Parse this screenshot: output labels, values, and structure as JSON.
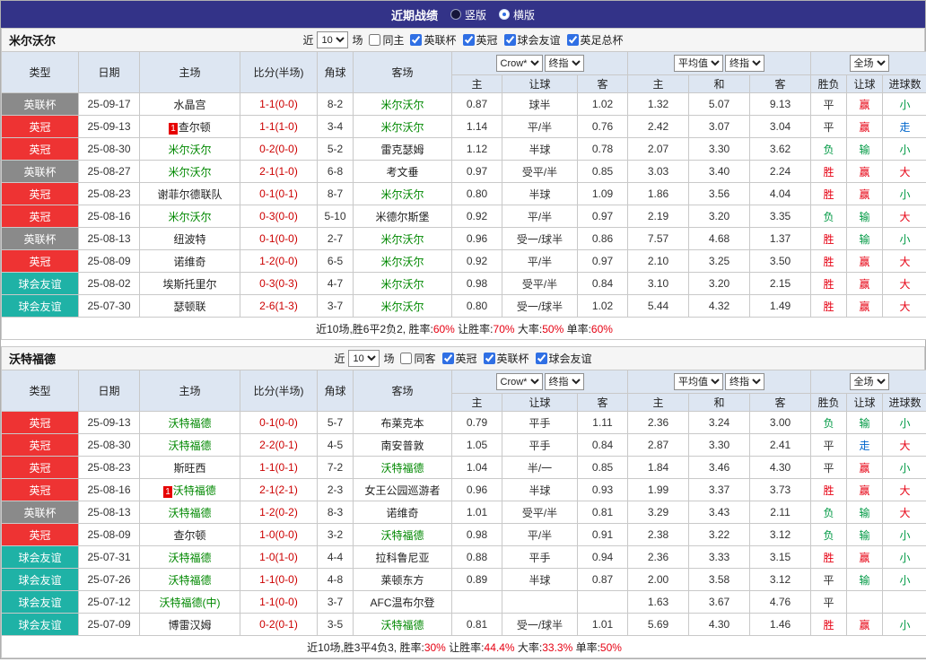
{
  "colors": {
    "topbar_bg": "#333388",
    "header_bg": "#dde6f2",
    "filter_bg": "#f5f5f5",
    "badge_cup": "#8a8a8a",
    "badge_league": "#ee3333",
    "badge_friendly": "#1fb2a6",
    "team_green": "#008800",
    "score_red": "#cc0000",
    "win_red": "#e60012",
    "lose_green": "#009944",
    "push_blue": "#0066cc"
  },
  "top_bar": {
    "title": "近期战绩",
    "options": [
      {
        "label": "竖版",
        "selected": false
      },
      {
        "label": "横版",
        "selected": true
      }
    ]
  },
  "table_header": {
    "type": "类型",
    "date": "日期",
    "home": "主场",
    "score": "比分(半场)",
    "corners": "角球",
    "away": "客场",
    "company_select": "Crow*",
    "final_select": "终指",
    "avg_select": "平均值",
    "avg_final_select": "终指",
    "full_select": "全场",
    "sub_headers": [
      "主",
      "让球",
      "客",
      "主",
      "和",
      "客",
      "胜负",
      "让球",
      "进球数"
    ]
  },
  "sections": [
    {
      "team": "米尔沃尔",
      "filter": {
        "prefix": "近",
        "count": "10",
        "suffix": "场",
        "checkboxes": [
          {
            "label": "同主",
            "checked": false
          },
          {
            "label": "英联杯",
            "checked": true
          },
          {
            "label": "英冠",
            "checked": true
          },
          {
            "label": "球会友谊",
            "checked": true
          },
          {
            "label": "英足总杯",
            "checked": true
          }
        ]
      },
      "rows": [
        {
          "type": "英联杯",
          "date": "25-09-17",
          "home": "水晶宫",
          "home_team": false,
          "rank": "",
          "score": "1-1(0-0)",
          "corners": "8-2",
          "away": "米尔沃尔",
          "away_team": true,
          "ah": [
            "0.87",
            "球半",
            "1.02"
          ],
          "eu": [
            "1.32",
            "5.07",
            "9.13"
          ],
          "res": [
            "平",
            "赢",
            "小"
          ]
        },
        {
          "type": "英冠",
          "date": "25-09-13",
          "home": "查尔顿",
          "home_team": false,
          "rank": "1",
          "score": "1-1(1-0)",
          "corners": "3-4",
          "away": "米尔沃尔",
          "away_team": true,
          "ah": [
            "1.14",
            "平/半",
            "0.76"
          ],
          "eu": [
            "2.42",
            "3.07",
            "3.04"
          ],
          "res": [
            "平",
            "赢",
            "走"
          ]
        },
        {
          "type": "英冠",
          "date": "25-08-30",
          "home": "米尔沃尔",
          "home_team": true,
          "rank": "",
          "score": "0-2(0-0)",
          "corners": "5-2",
          "away": "雷克瑟姆",
          "away_team": false,
          "ah": [
            "1.12",
            "半球",
            "0.78"
          ],
          "eu": [
            "2.07",
            "3.30",
            "3.62"
          ],
          "res": [
            "负",
            "输",
            "小"
          ]
        },
        {
          "type": "英联杯",
          "date": "25-08-27",
          "home": "米尔沃尔",
          "home_team": true,
          "rank": "",
          "score": "2-1(1-0)",
          "corners": "6-8",
          "away": "考文垂",
          "away_team": false,
          "ah": [
            "0.97",
            "受平/半",
            "0.85"
          ],
          "eu": [
            "3.03",
            "3.40",
            "2.24"
          ],
          "res": [
            "胜",
            "赢",
            "大"
          ]
        },
        {
          "type": "英冠",
          "date": "25-08-23",
          "home": "谢菲尔德联队",
          "home_team": false,
          "rank": "",
          "score": "0-1(0-1)",
          "corners": "8-7",
          "away": "米尔沃尔",
          "away_team": true,
          "ah": [
            "0.80",
            "半球",
            "1.09"
          ],
          "eu": [
            "1.86",
            "3.56",
            "4.04"
          ],
          "res": [
            "胜",
            "赢",
            "小"
          ]
        },
        {
          "type": "英冠",
          "date": "25-08-16",
          "home": "米尔沃尔",
          "home_team": true,
          "rank": "",
          "score": "0-3(0-0)",
          "corners": "5-10",
          "away": "米德尔斯堡",
          "away_team": false,
          "ah": [
            "0.92",
            "平/半",
            "0.97"
          ],
          "eu": [
            "2.19",
            "3.20",
            "3.35"
          ],
          "res": [
            "负",
            "输",
            "大"
          ]
        },
        {
          "type": "英联杯",
          "date": "25-08-13",
          "home": "纽波特",
          "home_team": false,
          "rank": "",
          "score": "0-1(0-0)",
          "corners": "2-7",
          "away": "米尔沃尔",
          "away_team": true,
          "ah": [
            "0.96",
            "受一/球半",
            "0.86"
          ],
          "eu": [
            "7.57",
            "4.68",
            "1.37"
          ],
          "res": [
            "胜",
            "输",
            "小"
          ]
        },
        {
          "type": "英冠",
          "date": "25-08-09",
          "home": "诺维奇",
          "home_team": false,
          "rank": "",
          "score": "1-2(0-0)",
          "corners": "6-5",
          "away": "米尔沃尔",
          "away_team": true,
          "ah": [
            "0.92",
            "平/半",
            "0.97"
          ],
          "eu": [
            "2.10",
            "3.25",
            "3.50"
          ],
          "res": [
            "胜",
            "赢",
            "大"
          ]
        },
        {
          "type": "球会友谊",
          "date": "25-08-02",
          "home": "埃斯托里尔",
          "home_team": false,
          "rank": "",
          "score": "0-3(0-3)",
          "corners": "4-7",
          "away": "米尔沃尔",
          "away_team": true,
          "ah": [
            "0.98",
            "受平/半",
            "0.84"
          ],
          "eu": [
            "3.10",
            "3.20",
            "2.15"
          ],
          "res": [
            "胜",
            "赢",
            "大"
          ]
        },
        {
          "type": "球会友谊",
          "date": "25-07-30",
          "home": "瑟顿联",
          "home_team": false,
          "rank": "",
          "score": "2-6(1-3)",
          "corners": "3-7",
          "away": "米尔沃尔",
          "away_team": true,
          "ah": [
            "0.80",
            "受一/球半",
            "1.02"
          ],
          "eu": [
            "5.44",
            "4.32",
            "1.49"
          ],
          "res": [
            "胜",
            "赢",
            "大"
          ]
        }
      ],
      "summary": {
        "prefix": "近10场,胜6平2负2,",
        "stats": [
          {
            "label": "胜率:",
            "value": "60%"
          },
          {
            "label": "让胜率:",
            "value": "70%"
          },
          {
            "label": "大率:",
            "value": "50%"
          },
          {
            "label": "单率:",
            "value": "60%"
          }
        ]
      }
    },
    {
      "team": "沃特福德",
      "filter": {
        "prefix": "近",
        "count": "10",
        "suffix": "场",
        "checkboxes": [
          {
            "label": "同客",
            "checked": false
          },
          {
            "label": "英冠",
            "checked": true
          },
          {
            "label": "英联杯",
            "checked": true
          },
          {
            "label": "球会友谊",
            "checked": true
          }
        ]
      },
      "rows": [
        {
          "type": "英冠",
          "date": "25-09-13",
          "home": "沃特福德",
          "home_team": true,
          "rank": "",
          "score": "0-1(0-0)",
          "corners": "5-7",
          "away": "布莱克本",
          "away_team": false,
          "ah": [
            "0.79",
            "平手",
            "1.11"
          ],
          "eu": [
            "2.36",
            "3.24",
            "3.00"
          ],
          "res": [
            "负",
            "输",
            "小"
          ]
        },
        {
          "type": "英冠",
          "date": "25-08-30",
          "home": "沃特福德",
          "home_team": true,
          "rank": "",
          "score": "2-2(0-1)",
          "corners": "4-5",
          "away": "南安普敦",
          "away_team": false,
          "ah": [
            "1.05",
            "平手",
            "0.84"
          ],
          "eu": [
            "2.87",
            "3.30",
            "2.41"
          ],
          "res": [
            "平",
            "走",
            "大"
          ]
        },
        {
          "type": "英冠",
          "date": "25-08-23",
          "home": "斯旺西",
          "home_team": false,
          "rank": "",
          "score": "1-1(0-1)",
          "corners": "7-2",
          "away": "沃特福德",
          "away_team": true,
          "ah": [
            "1.04",
            "半/一",
            "0.85"
          ],
          "eu": [
            "1.84",
            "3.46",
            "4.30"
          ],
          "res": [
            "平",
            "赢",
            "小"
          ]
        },
        {
          "type": "英冠",
          "date": "25-08-16",
          "home": "沃特福德",
          "home_team": true,
          "rank": "1",
          "score": "2-1(2-1)",
          "corners": "2-3",
          "away": "女王公园巡游者",
          "away_team": false,
          "ah": [
            "0.96",
            "半球",
            "0.93"
          ],
          "eu": [
            "1.99",
            "3.37",
            "3.73"
          ],
          "res": [
            "胜",
            "赢",
            "大"
          ]
        },
        {
          "type": "英联杯",
          "date": "25-08-13",
          "home": "沃特福德",
          "home_team": true,
          "rank": "",
          "score": "1-2(0-2)",
          "corners": "8-3",
          "away": "诺维奇",
          "away_team": false,
          "ah": [
            "1.01",
            "受平/半",
            "0.81"
          ],
          "eu": [
            "3.29",
            "3.43",
            "2.11"
          ],
          "res": [
            "负",
            "输",
            "大"
          ]
        },
        {
          "type": "英冠",
          "date": "25-08-09",
          "home": "查尔顿",
          "home_team": false,
          "rank": "",
          "score": "1-0(0-0)",
          "corners": "3-2",
          "away": "沃特福德",
          "away_team": true,
          "ah": [
            "0.98",
            "平/半",
            "0.91"
          ],
          "eu": [
            "2.38",
            "3.22",
            "3.12"
          ],
          "res": [
            "负",
            "输",
            "小"
          ]
        },
        {
          "type": "球会友谊",
          "date": "25-07-31",
          "home": "沃特福德",
          "home_team": true,
          "rank": "",
          "score": "1-0(1-0)",
          "corners": "4-4",
          "away": "拉科鲁尼亚",
          "away_team": false,
          "ah": [
            "0.88",
            "平手",
            "0.94"
          ],
          "eu": [
            "2.36",
            "3.33",
            "3.15"
          ],
          "res": [
            "胜",
            "赢",
            "小"
          ]
        },
        {
          "type": "球会友谊",
          "date": "25-07-26",
          "home": "沃特福德",
          "home_team": true,
          "rank": "",
          "score": "1-1(0-0)",
          "corners": "4-8",
          "away": "莱顿东方",
          "away_team": false,
          "ah": [
            "0.89",
            "半球",
            "0.87"
          ],
          "eu": [
            "2.00",
            "3.58",
            "3.12"
          ],
          "res": [
            "平",
            "输",
            "小"
          ]
        },
        {
          "type": "球会友谊",
          "date": "25-07-12",
          "home": "沃特福德(中)",
          "home_team": true,
          "rank": "",
          "score": "1-1(0-0)",
          "corners": "3-7",
          "away": "AFC温布尔登",
          "away_team": false,
          "ah": [
            "",
            "",
            ""
          ],
          "eu": [
            "1.63",
            "3.67",
            "4.76"
          ],
          "res": [
            "平",
            "",
            ""
          ]
        },
        {
          "type": "球会友谊",
          "date": "25-07-09",
          "home": "博雷汉姆",
          "home_team": false,
          "rank": "",
          "score": "0-2(0-1)",
          "corners": "3-5",
          "away": "沃特福德",
          "away_team": true,
          "ah": [
            "0.81",
            "受一/球半",
            "1.01"
          ],
          "eu": [
            "5.69",
            "4.30",
            "1.46"
          ],
          "res": [
            "胜",
            "赢",
            "小"
          ]
        }
      ],
      "summary": {
        "prefix": "近10场,胜3平4负3,",
        "stats": [
          {
            "label": "胜率:",
            "value": "30%"
          },
          {
            "label": "让胜率:",
            "value": "44.4%"
          },
          {
            "label": "大率:",
            "value": "33.3%"
          },
          {
            "label": "单率:",
            "value": "50%"
          }
        ]
      }
    }
  ]
}
